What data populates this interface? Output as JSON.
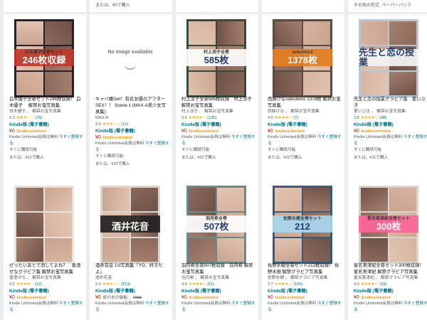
{
  "top_strip": [
    {
      "text": ""
    },
    {
      "text": "または、¥0で購入"
    },
    {
      "text": ""
    },
    {
      "text": ""
    },
    {
      "text": "その他の形式: ペーパーバック"
    }
  ],
  "cards": [
    {
      "title": "白木優子全巻セット246枚収録！ 白木優子 　解禁お宝写真集",
      "author": "白木優子 、 解禁お宝写真集",
      "rating": "3.3",
      "stars": "★★★☆☆",
      "count": "(70)",
      "format": "Kindle版 (電子書籍)",
      "price": "¥0",
      "ku": "kindleunlimited",
      "ku_text": "Kindle Unlimited会員は無料",
      "ku_link": "今すぐ登録する",
      "extra": "すぐに購読可能",
      "alt_price": "または、¥22で購入",
      "cover": {
        "bg": "#2a1e2a",
        "band": "#c0392b",
        "text": "246枚収録",
        "label": "白木優子全巻セット"
      }
    },
    {
      "title": "キャバ嬢Get！有名女優のアフターSEX！！ Scene.1 (MAX-A美少女写真集)",
      "author": "MAX-A",
      "rating": "3.3",
      "stars": "★★★☆☆",
      "count": "(13)",
      "format": "Kindle版 (電子書籍)",
      "price": "¥0",
      "ku": "kindleunlimited",
      "ku_text": "Kindle Unlimited会員は無料",
      "ku_link": "今すぐ登録する",
      "extra": "すぐに購読可能",
      "alt_price": "または、¥22で購入",
      "noimage": "No image available"
    },
    {
      "title": "村上涼子全巻585枚収録　村上涼子 解禁お宝写真集",
      "author": "村上涼子 、 解禁お宝写真集",
      "rating": "3.6",
      "stars": "★★★★☆",
      "count": "(130)",
      "format": "Kindle版 (電子書籍)",
      "price": "¥0",
      "ku": "kindleunlimited",
      "ku_text": "Kindle Unlimited会員は無料",
      "ku_link": "今すぐ登録する",
      "extra": "すぐに購読可能",
      "alt_price": "または、¥22で購入",
      "cover": {
        "bg": "#3a4a3a",
        "band": "#ffffff",
        "text": "585枚",
        "label": "村上涼子全巻"
      }
    },
    {
      "title": "西條けなselection2 1378枚 解禁お宝写真集",
      "author": "西條けな 、 解禁お宝写真集",
      "rating": "4.0",
      "stars": "★★★★☆",
      "count": "(7)",
      "format": "Kindle版 (電子書籍)",
      "price": "¥0",
      "ku": "kindleunlimited",
      "ku_text": "Kindle Unlimited会員は無料",
      "ku_link": "今すぐ登録する",
      "extra": "すぐに購読可能",
      "alt_price": "または、¥22で購入",
      "cover": {
        "bg": "#5a4a44",
        "band": "#e67e22",
        "text": "1378枚",
        "label": "selection2"
      }
    },
    {
      "title": "先生と恋の授業グラビア版　愛いぶき",
      "author": "愛いぶき 、 解禁お宝写真集",
      "rating": "3.8",
      "stars": "★★★★☆",
      "count": "(48)",
      "format": "Kindle版 (電子書籍)",
      "price": "¥0",
      "ku": "kindleunlimited",
      "ku_text": "Kindle Unlimited会員は無料",
      "ku_link": "今すぐ登録する",
      "extra": "すぐに購読可能",
      "alt_price": "または、¥11で購入",
      "cover": {
        "bg": "#b8c7d6",
        "band": "#f5f5f5",
        "text": "先生と恋の授業",
        "label": ""
      }
    },
    {
      "title": "ぜったいあとで消してよね？　香澄せなグラビア集 解禁お宝写真集",
      "author": "香澄せな 、 解禁お宝写真集",
      "rating": "4.2",
      "stars": "★★★★☆",
      "count": "(12)",
      "format": "Kindle版 (電子書籍)",
      "price": "¥0",
      "ku": "kindleunlimited",
      "ku_text": "Kindle Unlimited会員は無料",
      "ku_link": "今すぐ登録する",
      "extra": "",
      "alt_price": "",
      "cover": {
        "bg": "#e8e2dc",
        "band": "#ffffff",
        "text": "",
        "label": ""
      }
    },
    {
      "title": "酒井花音 1st写真集『YO、好きだよ』",
      "author": "酒井花音",
      "rating": "2.6",
      "stars": "★★★☆☆",
      "count": "(213)",
      "format": "Kindle版 (電子書籍)",
      "price": "¥0",
      "ku": "紙の本の価格：",
      "strike": "¥880",
      "ku_text": "Kindle Unlimited会員は無料",
      "ku_link": "今すぐ登録する",
      "extra": "",
      "alt_price": "",
      "cover": {
        "bg": "#ddd6d0",
        "band": "#222222",
        "text": "酒井花音",
        "label": "YO 写真集"
      }
    },
    {
      "title": "羽月希全巻507枚収録　羽月希 解禁お宝写真集",
      "author": "羽月希 、 解禁お宝写真集",
      "rating": "3.6",
      "stars": "★★★★☆",
      "count": "(51)",
      "format": "Kindle版 (電子書籍)",
      "price": "¥0",
      "ku": "kindleunlimited",
      "ku_text": "Kindle Unlimited会員は無料",
      "ku_link": "今すぐ登録する",
      "extra": "",
      "alt_price": "",
      "cover": {
        "bg": "#6a8a8a",
        "band": "#ffffff",
        "text": "507枚",
        "label": "羽月希全巻"
      }
    },
    {
      "title": "佐野水樹全巻セット212枚収録！ 佐野水樹 解禁グラビア写真集",
      "author": "佐野水樹 、 解禁グラビア写真集",
      "rating": "3.7",
      "stars": "★★★★☆",
      "count": "(105)",
      "format": "Kindle版 (電子書籍)",
      "price": "¥0",
      "ku": "kindleunlimited",
      "ku_text": "Kindle Unlimited会員は無料",
      "ku_link": "今すぐ登録する",
      "extra": "",
      "alt_price": "",
      "cover": {
        "bg": "#3a5a7a",
        "band": "#a8d8f0",
        "text": "212",
        "label": "佐野水樹全巻セット"
      }
    },
    {
      "title": "星名美津紀全巻セット300枚収録！ 星名美津紀 解禁グラビア写真集",
      "author": "星名美津紀 、 解禁グラビア写真集",
      "rating": "4.0",
      "stars": "★★★★☆",
      "count": "(43)",
      "format": "Kindle版 (電子書籍)",
      "price": "¥0",
      "ku": "kindleunlimited",
      "ku_text": "Kindle Unlimited会員は無料",
      "ku_link": "今すぐ登録する",
      "extra": "",
      "alt_price": "",
      "cover": {
        "bg": "#d8d4d0",
        "band": "#ff6699",
        "text": "300枚",
        "label": "星名美津紀全巻セット"
      }
    }
  ]
}
